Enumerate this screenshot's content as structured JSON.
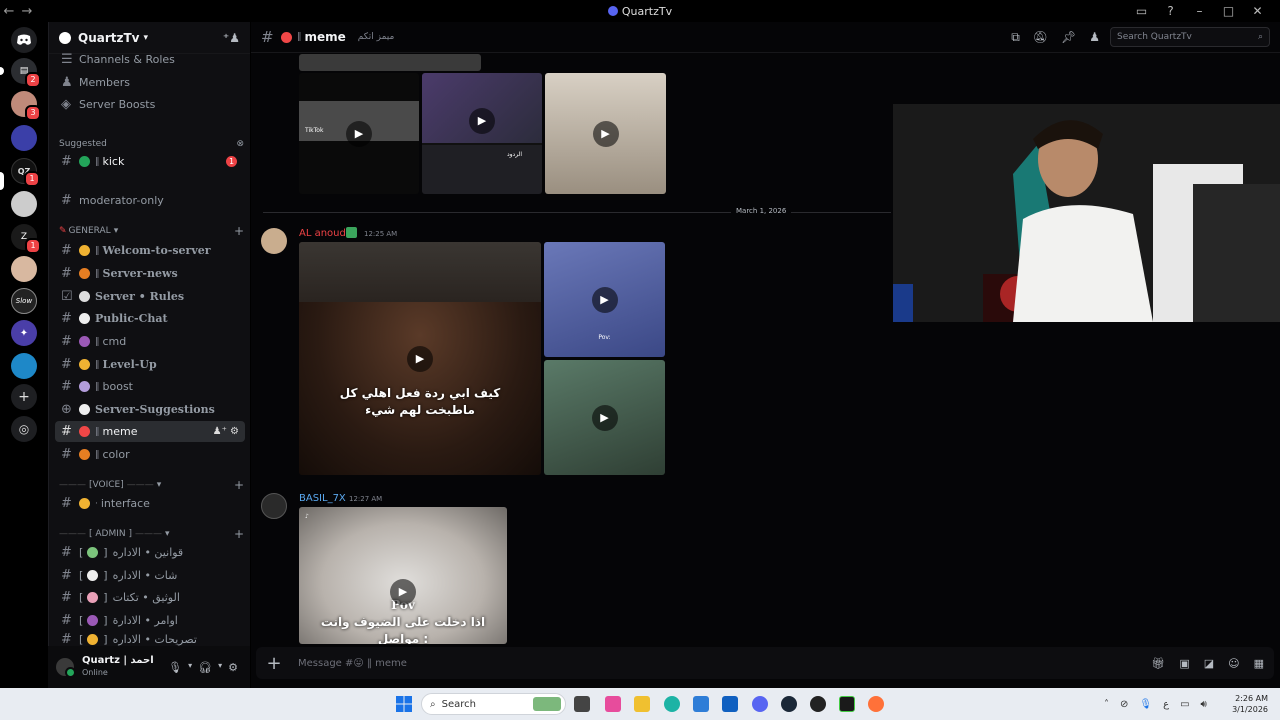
{
  "window": {
    "title": "QuartzTv",
    "back": "←",
    "forward": "→"
  },
  "rail": {
    "badges": [
      "2",
      "3",
      "1",
      "1"
    ]
  },
  "server": {
    "name": "QuartzTv"
  },
  "sidebar": {
    "top_items": [
      {
        "label": "Channels & Roles"
      },
      {
        "label": "Members"
      },
      {
        "label": "Server Boosts"
      }
    ],
    "suggested_label": "Suggested",
    "suggested_channel": {
      "label": "kick",
      "badge": "1"
    },
    "moderator": "moderator-only",
    "category_general": "GENERAL",
    "channels": [
      {
        "name": "Welcom-to-server",
        "serif": true
      },
      {
        "name": "Server-news",
        "serif": true
      },
      {
        "name": "Server • Rules",
        "serif": true
      },
      {
        "name": "Public-Chat",
        "serif": true
      },
      {
        "name": "cmd",
        "serif": false
      },
      {
        "name": "Level-Up",
        "serif": true
      },
      {
        "name": "boost",
        "serif": false
      },
      {
        "name": "Server-Suggestions",
        "serif": true
      },
      {
        "name": "meme",
        "serif": false
      },
      {
        "name": "color",
        "serif": false
      }
    ],
    "category_voice": "[VOICE]",
    "voice_channel": "interface",
    "category_admin": "[ ADMIN ]",
    "admin_channels": [
      {
        "name": "قوانين • الاداره"
      },
      {
        "name": "شات • الاداره"
      },
      {
        "name": "الوثيق • تكتات"
      },
      {
        "name": "اوامر • الادارة"
      },
      {
        "name": "تصريحات • الاداره"
      }
    ]
  },
  "user": {
    "name": "Quartz | احمد",
    "status": "Online"
  },
  "channel_header": {
    "name": "meme",
    "topic": "ميمز اتكم",
    "search_placeholder": "Search QuartzTv"
  },
  "messages": [
    {
      "author": "AL anoud",
      "time": "12:25 AM",
      "author_color": "#ed4245",
      "main_caption_line1": "كيف ابي ردة فعل اهلي كل",
      "main_caption_line2": "ماطبخت لهم شيء",
      "side_caption": "Pov:"
    },
    {
      "author": "BASIL_7X",
      "time": "12:27 AM",
      "author_color": "#5aa8ef",
      "caption_title": "Pov",
      "caption_line1": "اذا دخلت على الضيوف وانت",
      "caption_line2": "مواصل :"
    }
  ],
  "earlier_media": {
    "tiktok_label": "TikTok",
    "replies_label": "الردود"
  },
  "date_divider": "March 1, 2026",
  "composer": {
    "placeholder": "Message #😛 ‖ meme"
  },
  "taskbar": {
    "search_placeholder": "Search",
    "time": "2:26 AM",
    "date": "3/1/2026",
    "lang": "ع"
  }
}
